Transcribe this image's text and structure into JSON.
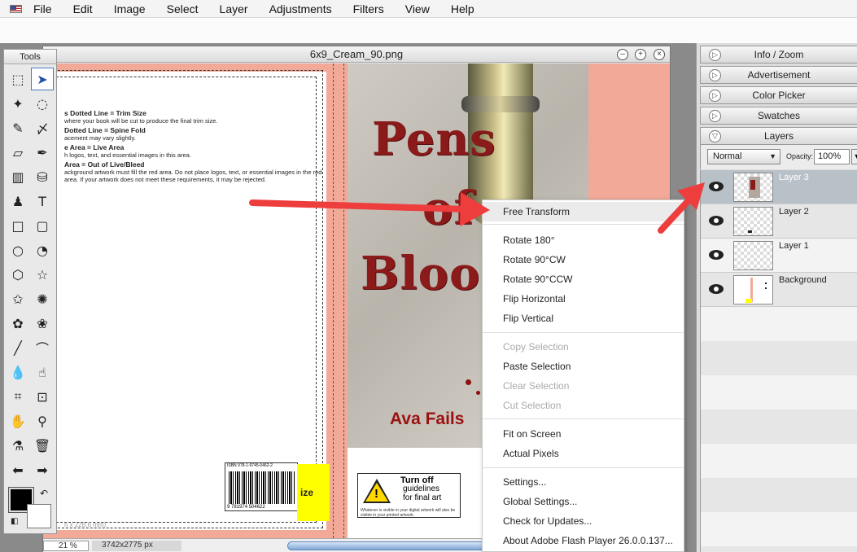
{
  "menubar": {
    "items": [
      "File",
      "Edit",
      "Image",
      "Select",
      "Layer",
      "Adjustments",
      "Filters",
      "View",
      "Help"
    ]
  },
  "document": {
    "title": "6x9_Cream_90.png",
    "zoom": "21 %",
    "size": "3742x2775 px",
    "notes": [
      {
        "head": "s Dotted Line = Trim Size",
        "body": "where your book will be cut to produce the final trim size."
      },
      {
        "head": "Dotted Line = Spine Fold",
        "body": "acement may vary slightly."
      },
      {
        "head": "e Area = Live Area",
        "body": "h logos, text, and essential images in this area."
      },
      {
        "head": "Area = Out of Live/Bleed",
        "body": "ackground artwork must fill the red area. Do not place logos, text, or essential images in the red area. If your artwork does not meet these requirements, it may be rejected."
      }
    ],
    "dim_text": "n x 228.6 mm)",
    "barcode_isbn": "ISBN 978-1-9745-0462-2",
    "barcode_number": "9 781974 504622",
    "yellow_text": "ize",
    "cover": {
      "title_lines": [
        "Pens",
        "of",
        "Blood"
      ],
      "author": "Ava Fails"
    },
    "warning": {
      "title": "Turn off",
      "sub1": "guidelines",
      "sub2": "for final art",
      "small": "Whatever is visible in your digital artwork will also be visible in your printed artwork."
    }
  },
  "tools": {
    "title": "Tools",
    "items": [
      {
        "name": "marquee-tool",
        "glyph": "⬚"
      },
      {
        "name": "move-tool",
        "glyph": "➤"
      },
      {
        "name": "magic-wand-tool",
        "glyph": "✦"
      },
      {
        "name": "lasso-tool",
        "glyph": "◌"
      },
      {
        "name": "pencil-tool",
        "glyph": "✎"
      },
      {
        "name": "brush-tool",
        "glyph": "〆"
      },
      {
        "name": "eraser-tool",
        "glyph": "▱"
      },
      {
        "name": "pen-tool",
        "glyph": "✒"
      },
      {
        "name": "gradient-tool",
        "glyph": "▥"
      },
      {
        "name": "bucket-tool",
        "glyph": "⛁"
      },
      {
        "name": "stamp-tool",
        "glyph": "♟"
      },
      {
        "name": "text-tool",
        "glyph": "T"
      },
      {
        "name": "rectangle-tool",
        "glyph": "□"
      },
      {
        "name": "rounded-rect-tool",
        "glyph": "▢"
      },
      {
        "name": "ellipse-tool",
        "glyph": "○"
      },
      {
        "name": "pie-tool",
        "glyph": "◔"
      },
      {
        "name": "polygon-tool",
        "glyph": "⬡"
      },
      {
        "name": "star-tool",
        "glyph": "☆"
      },
      {
        "name": "star-outline-tool",
        "glyph": "✩"
      },
      {
        "name": "burst-tool",
        "glyph": "✺"
      },
      {
        "name": "blob-tool",
        "glyph": "✿"
      },
      {
        "name": "flower-tool",
        "glyph": "❀"
      },
      {
        "name": "line-tool",
        "glyph": "╱"
      },
      {
        "name": "curve-tool",
        "glyph": "⌒"
      },
      {
        "name": "blur-tool",
        "glyph": "💧"
      },
      {
        "name": "smudge-tool",
        "glyph": "☝"
      },
      {
        "name": "crop-tool",
        "glyph": "⌗"
      },
      {
        "name": "transform-tool",
        "glyph": "⊡"
      },
      {
        "name": "hand-tool",
        "glyph": "✋"
      },
      {
        "name": "zoom-tool",
        "glyph": "⚲"
      },
      {
        "name": "eyedropper-tool",
        "glyph": "⚗"
      },
      {
        "name": "trash-tool",
        "glyph": "🗑"
      },
      {
        "name": "undo-arrow",
        "glyph": "⬅"
      },
      {
        "name": "redo-arrow",
        "glyph": "➡"
      }
    ],
    "active_index": 1,
    "swap_glyph": "↶",
    "reset_glyph": "◧"
  },
  "panels": {
    "info_zoom": "Info / Zoom",
    "advertisement": "Advertisement",
    "color_picker": "Color Picker",
    "swatches": "Swatches",
    "layers": "Layers",
    "blend_mode": "Normal",
    "opacity_label": "Opacity:",
    "opacity_value": "100%",
    "layer_items": [
      {
        "name": "Layer 3",
        "selected": true
      },
      {
        "name": "Layer 2",
        "selected": false
      },
      {
        "name": "Layer 1",
        "selected": false
      },
      {
        "name": "Background",
        "selected": false
      }
    ]
  },
  "context_menu": {
    "items": [
      {
        "label": "Free Transform",
        "state": "hover"
      },
      {
        "label": "Rotate 180°",
        "state": "normal"
      },
      {
        "label": "Rotate 90°CW",
        "state": "normal"
      },
      {
        "label": "Rotate 90°CCW",
        "state": "normal"
      },
      {
        "label": "Flip Horizontal",
        "state": "normal"
      },
      {
        "label": "Flip Vertical",
        "state": "normal"
      },
      {
        "label": "Copy Selection",
        "state": "disabled"
      },
      {
        "label": "Paste Selection",
        "state": "normal"
      },
      {
        "label": "Clear Selection",
        "state": "disabled"
      },
      {
        "label": "Cut Selection",
        "state": "disabled"
      },
      {
        "label": "Fit on Screen",
        "state": "normal"
      },
      {
        "label": "Actual Pixels",
        "state": "normal"
      },
      {
        "label": "Settings...",
        "state": "normal"
      },
      {
        "label": "Global Settings...",
        "state": "normal"
      },
      {
        "label": "Check for Updates...",
        "state": "normal"
      },
      {
        "label": "About Adobe Flash Player 26.0.0.137...",
        "state": "normal"
      }
    ]
  },
  "colors": {
    "arrow": "#ee3d3d",
    "bleed": "#f2a998",
    "title_red": "#8b1a1a",
    "selected_layer": "#b9c1c8"
  }
}
